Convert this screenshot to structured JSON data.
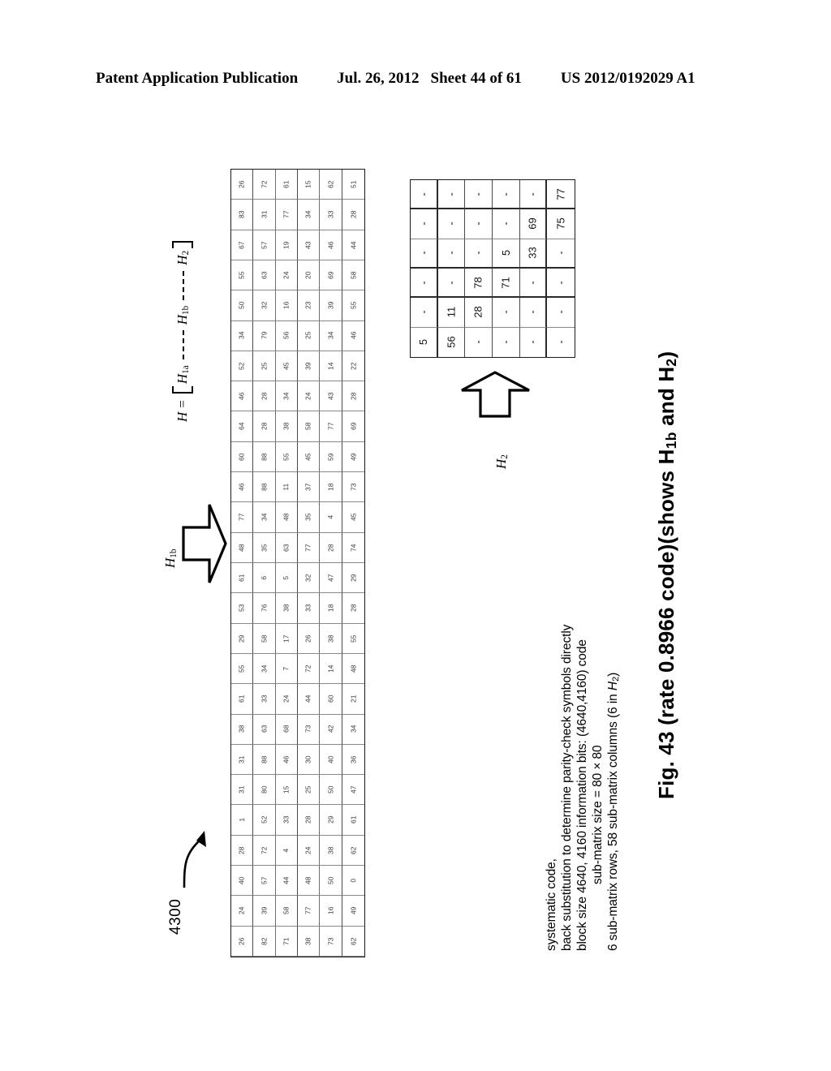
{
  "header": {
    "publication": "Patent Application Publication",
    "date": "Jul. 26, 2012",
    "sheet": "Sheet 44 of 61",
    "patent_number": "US 2012/0192029 A1"
  },
  "figure": {
    "caption_prefix": "Fig. 43 (rate 0.8966 code)(shows H",
    "caption_sub1": "1b",
    "caption_mid": " and H",
    "caption_sub2": "2",
    "caption_suffix": ")",
    "caption_full": "Fig. 43 (rate 0.8966 code)(shows H1b and H2)",
    "reference_numeral": "4300"
  },
  "equation": {
    "lhs": "H",
    "equals": "=",
    "term1": "H",
    "term1_sub": "1a",
    "term2": "H",
    "term2_sub": "1b",
    "term3": "H",
    "term3_sub": "2",
    "full": "H = [ H1a ┆ H1b ┆ H2 ]"
  },
  "labels": {
    "h1b_arrow": "H",
    "h1b_arrow_sub": "1b",
    "h2_arrow": "H",
    "h2_arrow_sub": "2"
  },
  "description": {
    "lines": [
      "systematic code,",
      "back substitution to determine parity-check symbols directly",
      "block size 4640, 4160 information bits: (4640,4160) code",
      "sub-matrix size = 80 × 80",
      "6 sub-matrix rows, 58 sub-matrix columns (6 in H2)"
    ],
    "line0": "systematic code,",
    "line1": "back substitution to determine parity-check symbols directly",
    "line2": "block size 4640, 4160 information bits: (4640,4160) code",
    "line3": "sub-matrix size = 80 × 80",
    "line4_a": "6 sub-matrix rows, 58 sub-matrix columns (6 in ",
    "line4_italic": "H",
    "line4_sub": "2",
    "line4_b": ")"
  },
  "chart_data": {
    "type": "table",
    "title": "H1b and H2 sub-matrix shift-value tables",
    "note": "Cell entries are circulant shift values; '-' denotes an all-zero sub-matrix. Matrices are drawn rotated 90 degrees on the sheet.",
    "h1b": {
      "name": "H1b",
      "sub_matrix_rows": 6,
      "sub_matrix_columns_shown": 26,
      "orientation": "rotated-90",
      "empty_marker": "-",
      "rows": [
        [
          "26",
          "72",
          "61",
          "15",
          "62",
          "51"
        ],
        [
          "83",
          "31",
          "77",
          "34",
          "33",
          "28"
        ],
        [
          "67",
          "57",
          "19",
          "43",
          "46",
          "44"
        ],
        [
          "55",
          "63",
          "24",
          "20",
          "69",
          "58"
        ],
        [
          "50",
          "32",
          "16",
          "23",
          "39",
          "55"
        ],
        [
          "34",
          "79",
          "56",
          "25",
          "34",
          "46"
        ],
        [
          "52",
          "25",
          "45",
          "39",
          "14",
          "22"
        ],
        [
          "46",
          "28",
          "34",
          "24",
          "43",
          "28"
        ],
        [
          "64",
          "28",
          "38",
          "58",
          "77",
          "69"
        ],
        [
          "60",
          "88",
          "55",
          "45",
          "59",
          "49"
        ],
        [
          "46",
          "88",
          "11",
          "37",
          "18",
          "73"
        ],
        [
          "77",
          "34",
          "48",
          "35",
          "4",
          "45"
        ],
        [
          "48",
          "35",
          "63",
          "77",
          "28",
          "74"
        ],
        [
          "61",
          "6",
          "5",
          "32",
          "47",
          "29"
        ],
        [
          "53",
          "76",
          "38",
          "33",
          "18",
          "28"
        ],
        [
          "29",
          "58",
          "17",
          "26",
          "38",
          "55"
        ],
        [
          "55",
          "34",
          "7",
          "72",
          "14",
          "48"
        ],
        [
          "61",
          "33",
          "24",
          "44",
          "60",
          "21"
        ],
        [
          "38",
          "63",
          "68",
          "73",
          "42",
          "34"
        ],
        [
          "31",
          "88",
          "46",
          "30",
          "40",
          "36"
        ],
        [
          "31",
          "80",
          "15",
          "25",
          "50",
          "47"
        ],
        [
          "1",
          "52",
          "33",
          "28",
          "29",
          "61"
        ],
        [
          "28",
          "72",
          "4",
          "24",
          "38",
          "62"
        ],
        [
          "40",
          "57",
          "44",
          "48",
          "50",
          "0"
        ],
        [
          "24",
          "39",
          "58",
          "77",
          "16",
          "49"
        ],
        [
          "26",
          "82",
          "71",
          "38",
          "73",
          "62"
        ]
      ]
    },
    "h2": {
      "name": "H2",
      "size": [
        6,
        6
      ],
      "orientation": "rotated-90",
      "empty_marker": "-",
      "rows": [
        [
          "-",
          "-",
          "-",
          "-",
          "-",
          "77"
        ],
        [
          "-",
          "-",
          "-",
          "-",
          "69",
          "75"
        ],
        [
          "-",
          "-",
          "-",
          "5",
          "33",
          "-"
        ],
        [
          "-",
          "-",
          "78",
          "71",
          "-",
          "-"
        ],
        [
          "-",
          "11",
          "28",
          "-",
          "-",
          "-"
        ],
        [
          "5",
          "56",
          "-",
          "-",
          "-",
          "-"
        ]
      ]
    }
  }
}
